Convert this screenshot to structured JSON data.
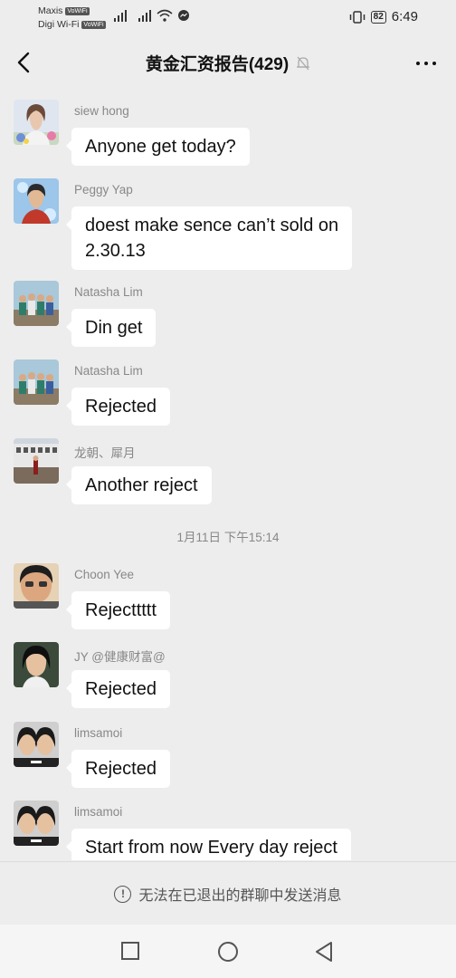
{
  "status_bar": {
    "carrier1": "Maxis",
    "carrier1_tag": "VoWiFi",
    "carrier2": "Digi Wi-Fi",
    "carrier2_tag": "VoWiFi",
    "battery": "82",
    "time": "6:49"
  },
  "header": {
    "title": "黄金汇资报告(429)",
    "back_icon": "chevron-left-icon",
    "mute_icon": "bell-off-icon",
    "more_icon": "more-horizontal-icon"
  },
  "messages": [
    {
      "sender": "siew hong",
      "text": "Anyone get today?",
      "avatar": "avatar-woman-flowers"
    },
    {
      "sender": "Peggy Yap",
      "lines": [
        "doest make sence can’t sold on",
        "2.30.13"
      ],
      "avatar": "avatar-woman-blue"
    },
    {
      "sender": "Natasha Lim",
      "text": "Din get",
      "avatar": "avatar-group-photo"
    },
    {
      "sender": "Natasha Lim",
      "text": "Rejected",
      "avatar": "avatar-group-photo"
    },
    {
      "sender": "龙朝、犀月",
      "text": "Another reject",
      "avatar": "avatar-building"
    },
    {
      "sender": "Choon Yee",
      "text": "Rejecttttt",
      "avatar": "avatar-man-selfie"
    },
    {
      "sender": "JY @健康财富@",
      "text": "Rejected",
      "avatar": "avatar-woman-portrait"
    },
    {
      "sender": "limsamoi",
      "text": "Rejected",
      "avatar": "avatar-two-women"
    },
    {
      "sender": "limsamoi",
      "text": "Start from now Every day reject",
      "avatar": "avatar-two-women"
    }
  ],
  "timestamp": "1月11日 下午15:14",
  "notice": {
    "text": "无法在已退出的群聊中发送消息",
    "icon": "alert-circle-icon"
  },
  "nav": {
    "recent_icon": "square-icon",
    "home_icon": "circle-icon",
    "back_icon": "triangle-back-icon"
  }
}
